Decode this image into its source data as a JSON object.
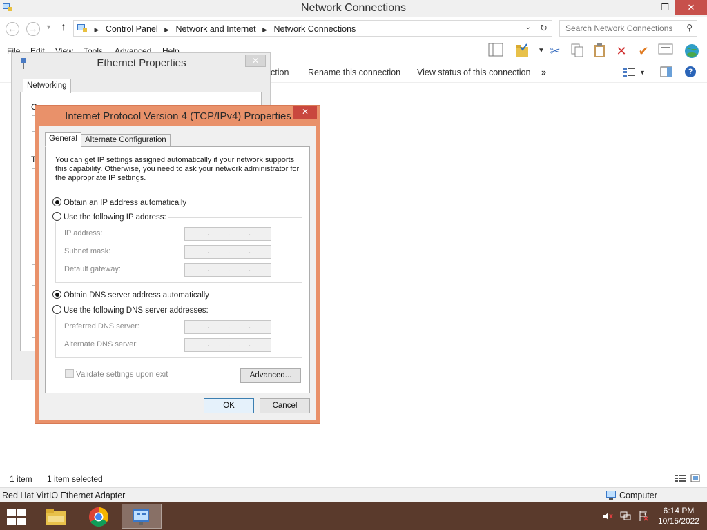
{
  "window": {
    "title": "Network Connections",
    "min_glyph": "–",
    "max_glyph": "❐",
    "close_glyph": "✕"
  },
  "nav": {
    "back_glyph": "←",
    "forward_glyph": "→",
    "dropdown_glyph": "▼",
    "up_glyph": "↑",
    "breadcrumbs": [
      "Control Panel",
      "Network and Internet",
      "Network Connections"
    ],
    "breadcrumb_sep": "▶",
    "address_dropdown_glyph": "⌄",
    "refresh_glyph": "↻",
    "search_placeholder": "Search Network Connections",
    "search_glyph": "⚲"
  },
  "menu": {
    "items": [
      "File",
      "Edit",
      "View",
      "Tools",
      "Advanced",
      "Help"
    ]
  },
  "toolbar": {
    "icons": [
      "pane-icon",
      "folder-check-icon",
      "cut-icon",
      "copy-icon",
      "paste-icon",
      "delete-icon",
      "checkmark-icon",
      "properties-icon",
      "globe-icon"
    ]
  },
  "commands": {
    "partial": "ction",
    "rename": "Rename this connection",
    "view_status": "View status of this connection",
    "more": "»",
    "help_glyph": "?"
  },
  "status": {
    "items": "1 item",
    "selected": "1 item selected",
    "adapter": "Red Hat VirtIO Ethernet Adapter",
    "computer": "Computer"
  },
  "taskbar": {
    "time": "6:14 PM",
    "date": "10/15/2022"
  },
  "ethernet_dialog": {
    "title": "Ethernet Properties",
    "close_glyph": "✕",
    "tab": "Networking",
    "fragment_c": "C",
    "fragment_t": "T"
  },
  "ipv4_dialog": {
    "title": "Internet Protocol Version 4 (TCP/IPv4) Properties",
    "close_glyph": "✕",
    "tabs": [
      "General",
      "Alternate Configuration"
    ],
    "intro": "You can get IP settings assigned automatically if your network supports this capability. Otherwise, you need to ask your network administrator for the appropriate IP settings.",
    "ip_auto": "Obtain an IP address automatically",
    "ip_manual": "Use the following IP address:",
    "ip_address_label": "IP address:",
    "subnet_label": "Subnet mask:",
    "gateway_label": "Default gateway:",
    "dns_auto": "Obtain DNS server address automatically",
    "dns_manual": "Use the following DNS server addresses:",
    "preferred_dns_label": "Preferred DNS server:",
    "alternate_dns_label": "Alternate DNS server:",
    "ip_dot": ".",
    "validate": "Validate settings upon exit",
    "advanced": "Advanced...",
    "ok": "OK",
    "cancel": "Cancel",
    "selected_ip_mode": "automatic",
    "selected_dns_mode": "automatic",
    "validate_checked": false
  },
  "colors": {
    "dialog_accent": "#e9916a",
    "close_red": "#c9473e",
    "taskbar": "#5a3a2c"
  }
}
